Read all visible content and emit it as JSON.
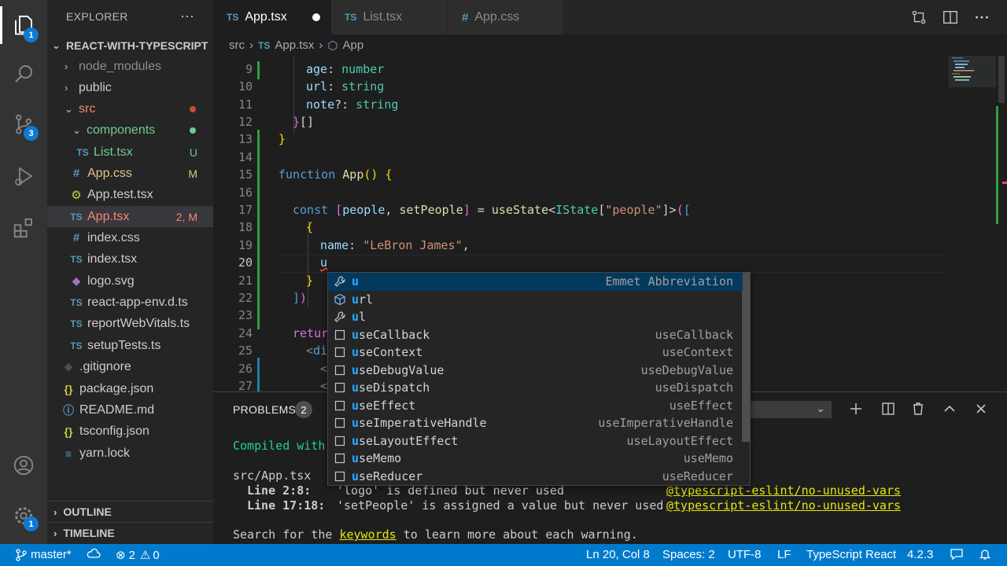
{
  "activity": {
    "explorer_badge": "1",
    "scm_badge": "3",
    "settings_badge": "1"
  },
  "sidebar": {
    "title": "EXPLORER",
    "more": "···",
    "project": "REACT-WITH-TYPESCRIPT",
    "items": [
      {
        "label": "node_modules",
        "type": "folder"
      },
      {
        "label": "public",
        "type": "folder"
      },
      {
        "label": "src",
        "type": "folder-open"
      },
      {
        "label": "components",
        "type": "folder-open"
      },
      {
        "label": "List.tsx",
        "icon": "TS",
        "badge": "U"
      },
      {
        "label": "App.css",
        "icon": "#",
        "badge": "M"
      },
      {
        "label": "App.test.tsx",
        "icon": "⚙"
      },
      {
        "label": "App.tsx",
        "icon": "TS",
        "badge": "2, M"
      },
      {
        "label": "index.css",
        "icon": "#"
      },
      {
        "label": "index.tsx",
        "icon": "TS"
      },
      {
        "label": "logo.svg",
        "icon": "◆"
      },
      {
        "label": "react-app-env.d.ts",
        "icon": "TS"
      },
      {
        "label": "reportWebVitals.ts",
        "icon": "TS"
      },
      {
        "label": "setupTests.ts",
        "icon": "TS"
      },
      {
        "label": ".gitignore",
        "icon": "◆"
      },
      {
        "label": "package.json",
        "icon": "{}"
      },
      {
        "label": "README.md",
        "icon": "ⓘ"
      },
      {
        "label": "tsconfig.json",
        "icon": "{}"
      },
      {
        "label": "yarn.lock",
        "icon": "≡"
      }
    ],
    "outline": "OUTLINE",
    "timeline": "TIMELINE"
  },
  "tabs": [
    {
      "icon": "TS",
      "label": "App.tsx"
    },
    {
      "icon": "TS",
      "label": "List.tsx"
    },
    {
      "icon": "#",
      "label": "App.css"
    }
  ],
  "breadcrumb": {
    "folder": "src",
    "file_icon": "TS",
    "file": "App.tsx",
    "symbol": "App"
  },
  "editor": {
    "line_numbers": [
      "9",
      "10",
      "11",
      "12",
      "13",
      "14",
      "15",
      "16",
      "17",
      "18",
      "19",
      "20",
      "21",
      "22",
      "23",
      "24",
      "25",
      "26",
      "27"
    ],
    "current_line_text": "u"
  },
  "suggest": [
    {
      "kind": "wrench-icon",
      "label": "u",
      "rest": "",
      "detail": "Emmet Abbreviation"
    },
    {
      "kind": "cube-icon",
      "label": "u",
      "rest": "rl",
      "detail": ""
    },
    {
      "kind": "wrench-icon",
      "label": "u",
      "rest": "l",
      "detail": ""
    },
    {
      "kind": "box-icon",
      "label": "u",
      "rest": "seCallback",
      "detail": "useCallback"
    },
    {
      "kind": "box-icon",
      "label": "u",
      "rest": "seContext",
      "detail": "useContext"
    },
    {
      "kind": "box-icon",
      "label": "u",
      "rest": "seDebugValue",
      "detail": "useDebugValue"
    },
    {
      "kind": "box-icon",
      "label": "u",
      "rest": "seDispatch",
      "detail": "useDispatch"
    },
    {
      "kind": "box-icon",
      "label": "u",
      "rest": "seEffect",
      "detail": "useEffect"
    },
    {
      "kind": "box-icon",
      "label": "u",
      "rest": "seImperativeHandle",
      "detail": "useImperativeHandle"
    },
    {
      "kind": "box-icon",
      "label": "u",
      "rest": "seLayoutEffect",
      "detail": "useLayoutEffect"
    },
    {
      "kind": "box-icon",
      "label": "u",
      "rest": "seMemo",
      "detail": "useMemo"
    },
    {
      "kind": "box-icon",
      "label": "u",
      "rest": "seReducer",
      "detail": "useReducer"
    }
  ],
  "panel": {
    "problems_label": "PROBLEMS",
    "problems_count": "2",
    "compiled": "Compiled with",
    "file": "src/App.tsx",
    "w1_loc": "Line 2:8:",
    "w1_msg": "'logo' is defined but never used",
    "w1_rule": "@typescript-eslint/no-unused-vars",
    "w2_loc": "Line 17:18:",
    "w2_msg": "'setPeople' is assigned a value but never used",
    "w2_rule": "@typescript-eslint/no-unused-vars",
    "search_pre": "Search for the ",
    "search_kw": "keywords",
    "search_post": " to learn more about each warning."
  },
  "status": {
    "branch": "master*",
    "errors": "2",
    "warnings": "0",
    "position": "Ln 20, Col 8",
    "spaces": "Spaces: 2",
    "encoding": "UTF-8",
    "eol": "LF",
    "language": "TypeScript React",
    "version": "4.2.3"
  },
  "colors": {
    "accent": "#007acc",
    "ts_blue": "#519aba",
    "modified": "#e2c08d",
    "error": "#f14c4c",
    "untracked": "#73c991"
  }
}
